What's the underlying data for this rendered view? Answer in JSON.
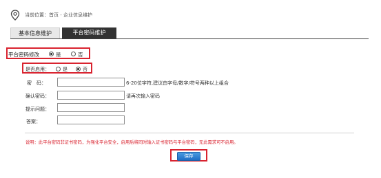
{
  "breadcrumb": {
    "prefix": "当前位置：",
    "home": "首页",
    "separator": " - ",
    "current": "企业信息维护"
  },
  "tabs": [
    {
      "label": "基本信息维护",
      "active": false
    },
    {
      "label": "平台密码维护",
      "active": true
    }
  ],
  "platform_pwd": {
    "label": "平台密码修改",
    "options": [
      {
        "label": "是",
        "checked": true
      },
      {
        "label": "否",
        "checked": false
      }
    ]
  },
  "enable": {
    "label": "是否启用：",
    "options": [
      {
        "label": "是",
        "checked": false
      },
      {
        "label": "否",
        "checked": true
      }
    ]
  },
  "fields": [
    {
      "label": "密　码：",
      "value": "",
      "hint": "6-20位字符,建议由字母/数字/符号两种以上组合"
    },
    {
      "label": "确认密码：",
      "value": "",
      "hint": "请再次输入密码"
    },
    {
      "label": "提示问题：",
      "value": "",
      "hint": ""
    },
    {
      "label": "答案：",
      "value": "",
      "hint": ""
    }
  ],
  "note": "说明：此平台密码非证书密码，为强化平台安全，启用后将同时输入证书密码与平台密码，无此需求可不启用。",
  "save_label": "保存",
  "colors": {
    "accent_red": "#d9232f",
    "tab_active_bg": "#333333",
    "button_blue": "#2a7fd4"
  }
}
